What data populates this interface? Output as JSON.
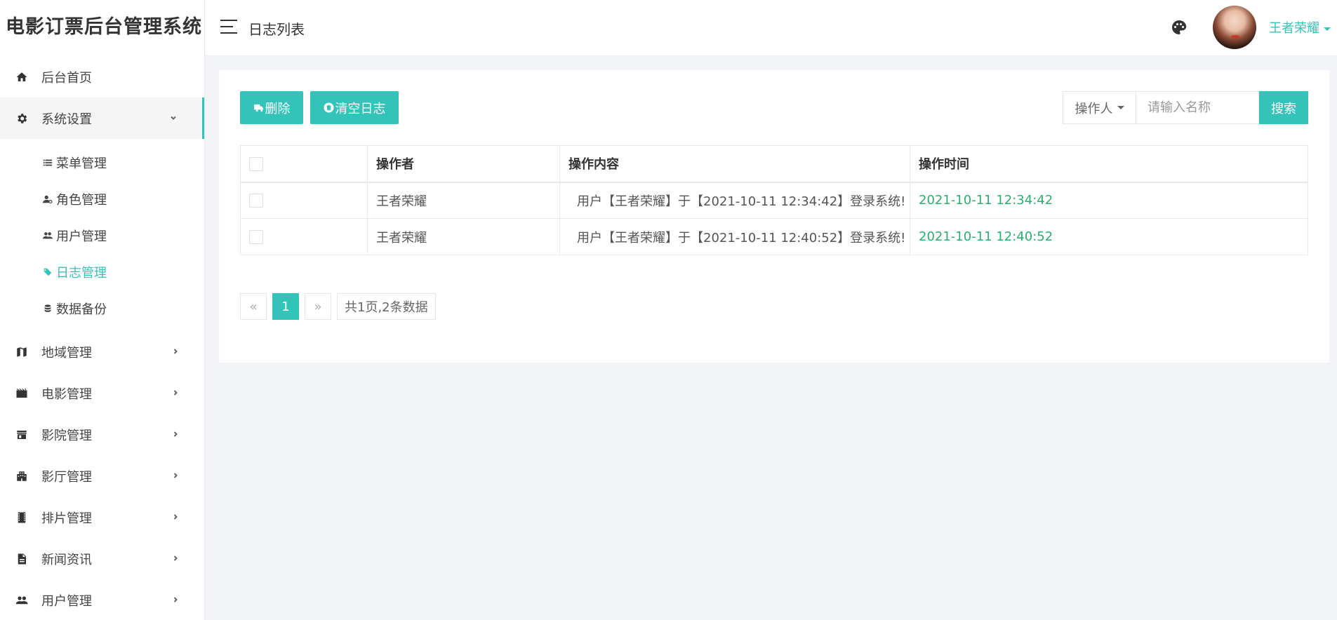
{
  "app": {
    "brand": "电影订票后台管理系统",
    "header_title": "日志列表",
    "accent_color": "#34c3b9"
  },
  "user": {
    "name": "王者荣耀"
  },
  "sidebar": {
    "items": [
      {
        "label": "后台首页",
        "icon": "home-icon"
      },
      {
        "label": "系统设置",
        "icon": "gear-icon",
        "expanded": true,
        "children": [
          {
            "label": "菜单管理",
            "icon": "list-icon"
          },
          {
            "label": "角色管理",
            "icon": "user-role-icon"
          },
          {
            "label": "用户管理",
            "icon": "users-icon"
          },
          {
            "label": "日志管理",
            "icon": "tag-icon",
            "active": true
          },
          {
            "label": "数据备份",
            "icon": "database-icon"
          }
        ]
      },
      {
        "label": "地域管理",
        "icon": "map-icon"
      },
      {
        "label": "电影管理",
        "icon": "film-icon"
      },
      {
        "label": "影院管理",
        "icon": "store-icon"
      },
      {
        "label": "影厅管理",
        "icon": "building-icon"
      },
      {
        "label": "排片管理",
        "icon": "filmstrip-icon"
      },
      {
        "label": "新闻资讯",
        "icon": "document-icon"
      },
      {
        "label": "用户管理",
        "icon": "people-icon"
      }
    ]
  },
  "toolbar": {
    "delete_label": "删除",
    "clear_label": "清空日志"
  },
  "search": {
    "select_label": "操作人",
    "placeholder": "请输入名称",
    "button_label": "搜索"
  },
  "table": {
    "headers": [
      "",
      "操作者",
      "操作内容",
      "操作时间"
    ],
    "rows": [
      {
        "operator": "王者荣耀",
        "content": "用户【王者荣耀】于【2021-10-11 12:34:42】登录系统!",
        "time": "2021-10-11 12:34:42"
      },
      {
        "operator": "王者荣耀",
        "content": "用户【王者荣耀】于【2021-10-11 12:40:52】登录系统!",
        "time": "2021-10-11 12:40:52"
      }
    ]
  },
  "pager": {
    "prev": "«",
    "current": "1",
    "next": "»",
    "info": "共1页,2条数据"
  }
}
